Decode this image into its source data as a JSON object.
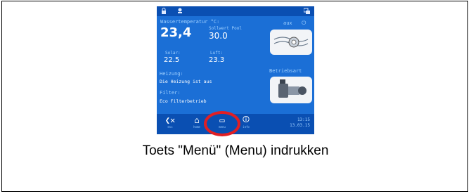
{
  "screen": {
    "icons": {
      "top_left": "lock-icon",
      "top_second": "fan-icon",
      "top_right": "network-icon"
    },
    "water_temp_label": "Wassertemperatur °C:",
    "water_temp_value": "23,4",
    "setpoint_label": "Sollwert Pool",
    "setpoint_value": "30.0",
    "solar_label": "Solar:",
    "solar_value": "22.5",
    "air_label": "Luft:",
    "air_value": "23.3",
    "aux_label": "aux",
    "heating_label": "Heizung:",
    "heating_status": "Die Heizung ist aus",
    "filter_label": "Filter:",
    "filter_status": "Eco Filterbetrieb",
    "operating_mode_label": "Betriebsart",
    "nav": {
      "esc": "esc",
      "home": "home",
      "menu": "menu",
      "info": "info"
    },
    "time": "13:15",
    "date": "13.03.15"
  },
  "caption": "Toets \"Menü\" (Menu) indrukken",
  "colors": {
    "screen_bg": "#1b6fd6",
    "bar_bg": "#0a4fb2",
    "highlight_ring": "#e11f24"
  }
}
